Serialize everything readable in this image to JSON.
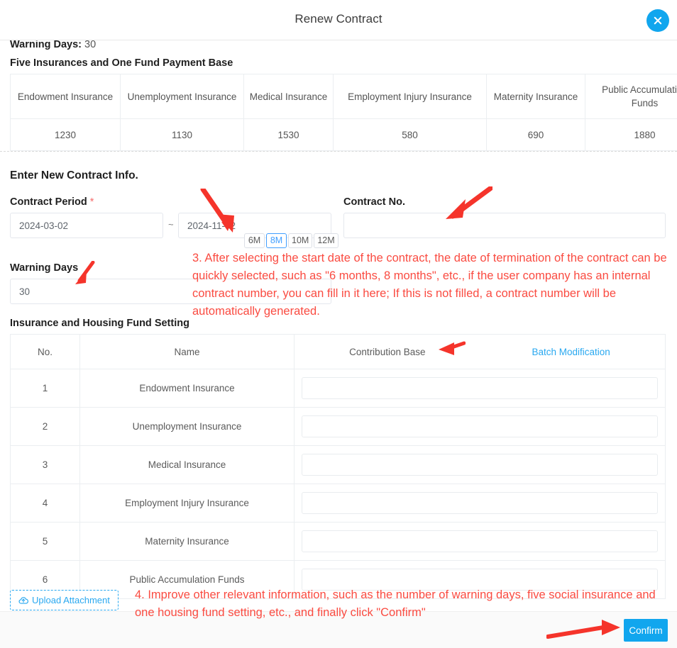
{
  "header": {
    "title": "Renew Contract",
    "close_icon": "close-circle-icon"
  },
  "existing_contract": {
    "warning_days_label": "Warning Days:",
    "warning_days_value": "30",
    "payment_base_heading": "Five Insurances and One Fund Payment Base",
    "payment_base_table": {
      "columns": [
        "Endowment Insurance",
        "Unemployment Insurance",
        "Medical Insurance",
        "Employment Injury Insurance",
        "Maternity Insurance",
        "Public Accumulation Funds"
      ],
      "values": [
        "1230",
        "1130",
        "1530",
        "580",
        "690",
        "1880"
      ]
    }
  },
  "new_contract": {
    "heading": "Enter New Contract Info.",
    "contract_period_label": "Contract Period",
    "required_mark": "*",
    "start_date": "2024-03-02",
    "date_separator": "~",
    "end_date": "2024-11-02",
    "quick_months": [
      {
        "label": "6M",
        "active": false
      },
      {
        "label": "8M",
        "active": true
      },
      {
        "label": "10M",
        "active": false
      },
      {
        "label": "12M",
        "active": false
      }
    ],
    "contract_no_label": "Contract No.",
    "contract_no_value": "",
    "contract_no_placeholder": "",
    "warning_days_label": "Warning Days",
    "warning_days_value": "30"
  },
  "insurance_setting": {
    "heading": "Insurance and Housing Fund Setting",
    "columns": {
      "no": "No.",
      "name": "Name",
      "contribution_base": "Contribution Base",
      "batch_modification": "Batch Modification"
    },
    "rows": [
      {
        "no": "1",
        "name": "Endowment Insurance",
        "base": ""
      },
      {
        "no": "2",
        "name": "Unemployment Insurance",
        "base": ""
      },
      {
        "no": "3",
        "name": "Medical Insurance",
        "base": ""
      },
      {
        "no": "4",
        "name": "Employment Injury Insurance",
        "base": ""
      },
      {
        "no": "5",
        "name": "Maternity Insurance",
        "base": ""
      },
      {
        "no": "6",
        "name": "Public Accumulation Funds",
        "base": ""
      }
    ]
  },
  "upload": {
    "label": "Upload Attachment",
    "icon": "cloud-upload-icon"
  },
  "footer": {
    "confirm_label": "Confirm"
  },
  "annotations": [
    {
      "id": "step-3",
      "text": "3. After selecting the start date of the contract, the date of termination of the contract can be quickly selected, such as \"6 months, 8 months\", etc., if the user company has an internal contract number, you can fill in it here; If this is not filled, a contract number will be automatically generated."
    },
    {
      "id": "step-4",
      "text": "4. Improve other relevant information, such as the number of warning days, five social insurance and one housing fund setting, etc., and finally click \"Confirm\""
    }
  ],
  "colors": {
    "accent_blue": "#11a6ee",
    "link_blue": "#29a8f0",
    "active_border_blue": "#409eff",
    "annotation_red": "#fa4b41",
    "required_red": "#f56c6c"
  }
}
